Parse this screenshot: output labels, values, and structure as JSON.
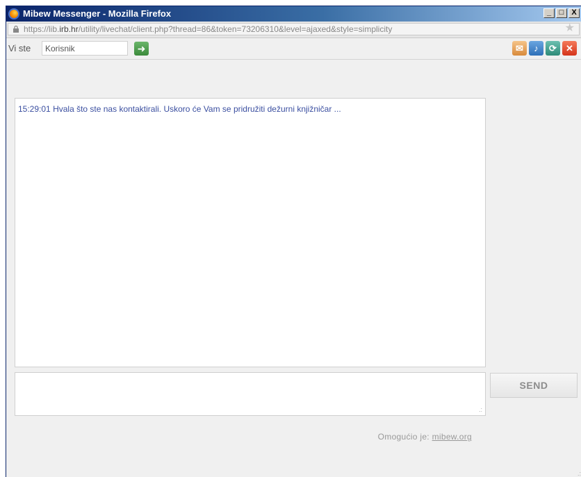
{
  "window": {
    "title": "Mibew Messenger - Mozilla Firefox",
    "buttons": {
      "minimize": "_",
      "maximize": "□",
      "close": "X"
    }
  },
  "urlbar": {
    "url_prefix": "https://lib.",
    "url_domain": "irb.hr",
    "url_rest": "/utility/livechat/client.php?thread=86&token=73206310&level=ajaxed&style=simplicity"
  },
  "toolbar": {
    "you_label": "Vi ste",
    "name_value": "Korisnik",
    "icons": [
      "mail-icon",
      "sound-icon",
      "refresh-icon",
      "close-icon"
    ]
  },
  "chat": {
    "messages": [
      {
        "time": "15:29:01",
        "text": "Hvala što ste nas kontaktirali. Uskoro će Vam se pridružiti dežurni knjižničar ..."
      }
    ]
  },
  "compose": {
    "send_label": "SEND"
  },
  "footer": {
    "powered_label": "Omogućio je:",
    "powered_link": "mibew.org"
  },
  "colors": {
    "title_gradient_start": "#0a246a",
    "message_text": "#3b4fa0",
    "send_text": "#8c8c8c"
  }
}
